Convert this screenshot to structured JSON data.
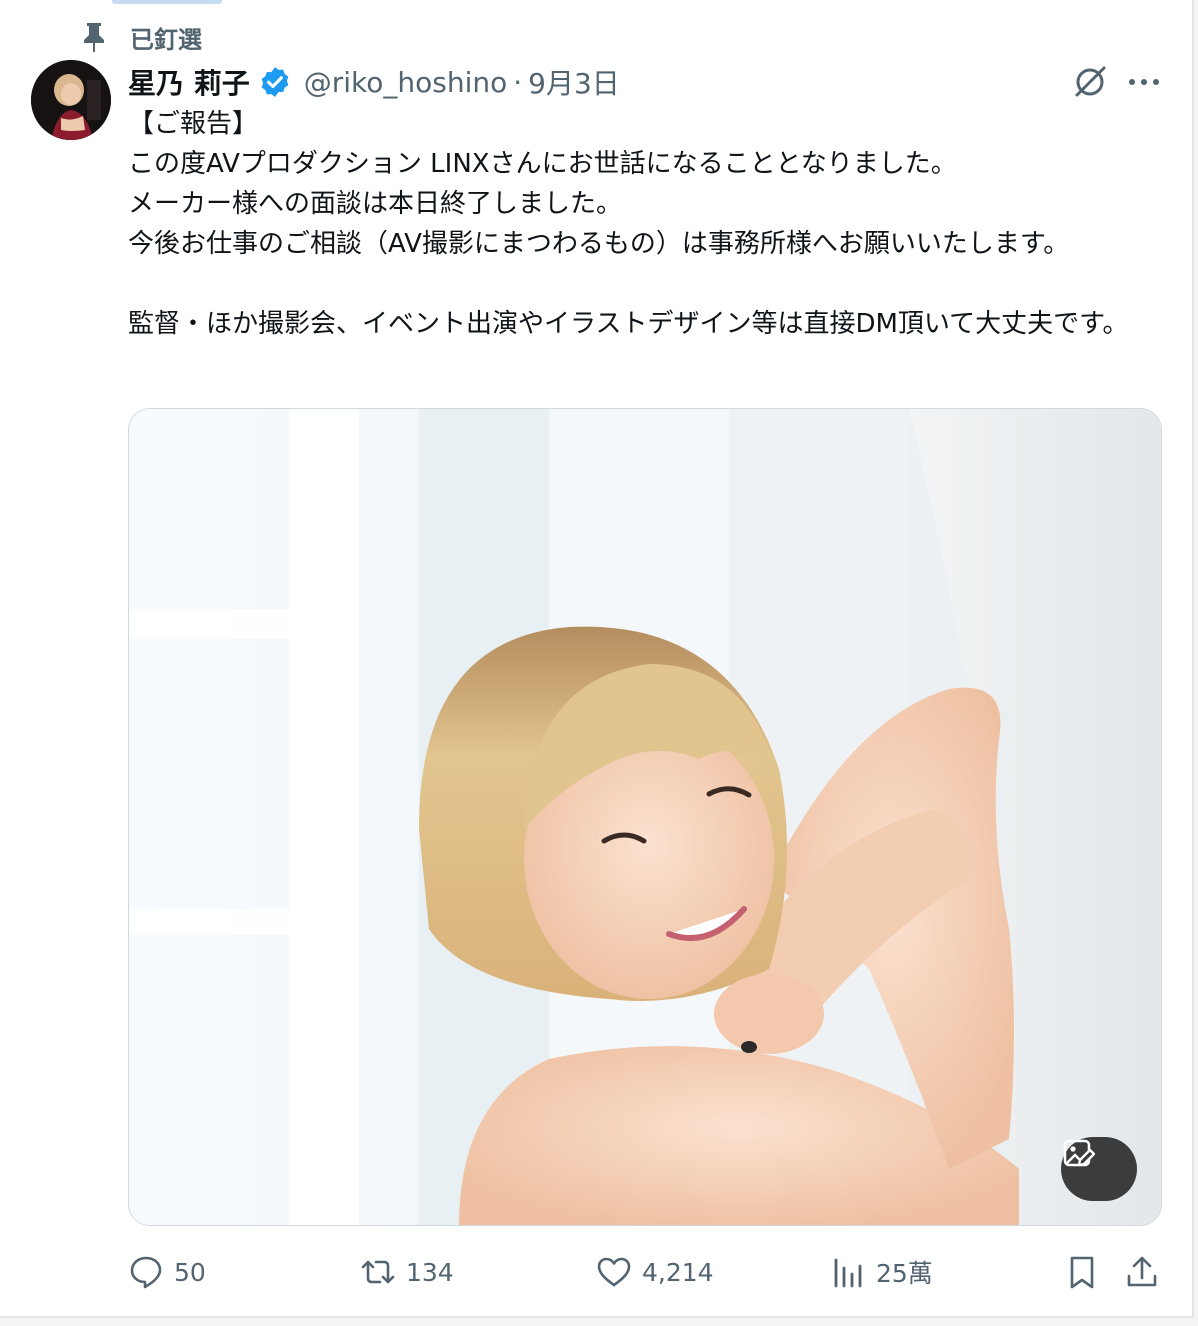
{
  "pinned_label": "已釘選",
  "author": {
    "display_name": "星乃 莉子",
    "handle": "@riko_hoshino",
    "separator": "·",
    "date": "9月3日",
    "verified_color": "#1d9bf0"
  },
  "body_lines": [
    "【ご報告】",
    "この度AVプロダクション LINXさんにお世話になることとなりました。",
    "メーカー様への面談は本日終了しました。",
    "今後お仕事のご相談（AV撮影にまつわるもの）は事務所様へお願いいたします。",
    "監督・ほか撮影会、イベント出演やイラストデザイン等は直接DM頂いて大丈夫です。"
  ],
  "media": {
    "alt_button_icon": "alt-image-edit-icon"
  },
  "actions": {
    "replies": "50",
    "retweets": "134",
    "likes": "4,214",
    "views": "25萬"
  },
  "icons": {
    "pin": "pin-icon",
    "grok": "grok-icon",
    "more": "more-icon",
    "reply": "reply-icon",
    "retweet": "retweet-icon",
    "like": "heart-icon",
    "views": "views-icon",
    "bookmark": "bookmark-icon",
    "share": "share-icon"
  },
  "colors": {
    "secondary_text": "#536471",
    "primary_text": "#0f1419"
  }
}
